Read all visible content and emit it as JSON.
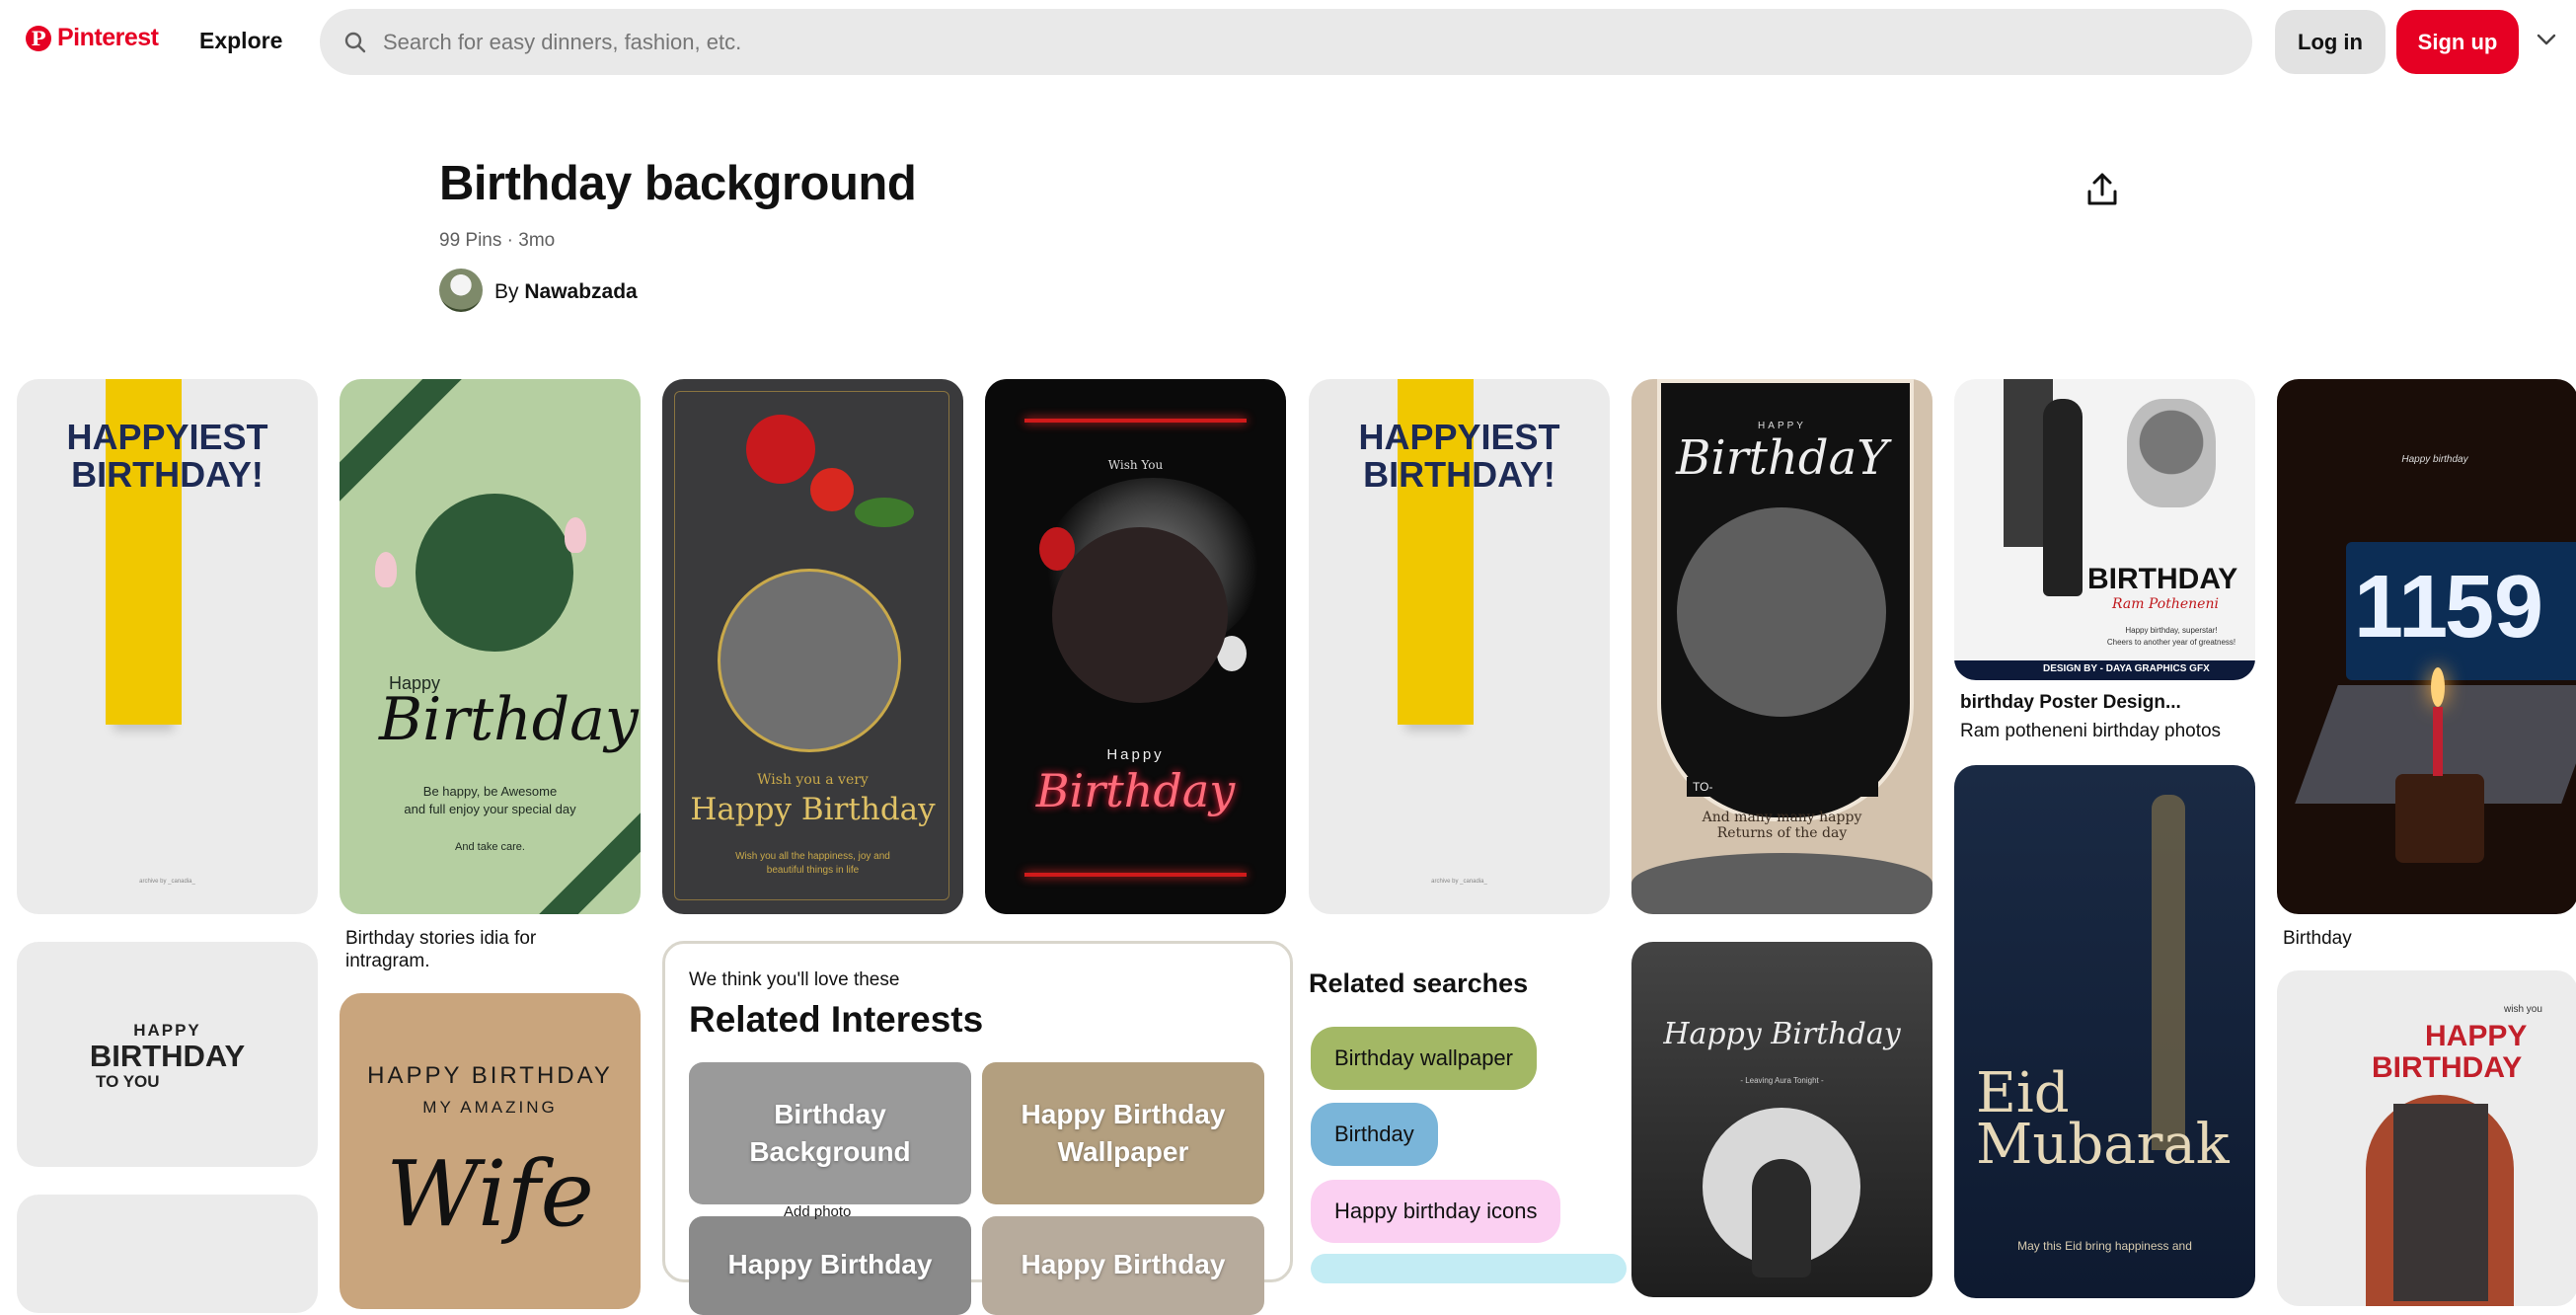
{
  "header": {
    "logo_text": "Pinterest",
    "logo_glyph": "P",
    "explore_label": "Explore",
    "search_placeholder": "Search for easy dinners, fashion, etc.",
    "login_label": "Log in",
    "signup_label": "Sign up",
    "brand_color": "#e60023"
  },
  "board": {
    "title": "Birthday background",
    "meta": "99 Pins · 3mo",
    "by_prefix": "By",
    "author": "Nawabzada"
  },
  "pins": {
    "p1": {
      "line1": "HAPPYIEST",
      "line2": "BIRTHDAY!",
      "small": "archive by _canadia_"
    },
    "p2": {
      "happy": "Happy",
      "script": "Birthday",
      "text1": "Be happy, be Awesome",
      "text2": "and full enjoy your special day",
      "text3": "And take care.",
      "caption1": "Birthday stories idia for",
      "caption2": "intragram."
    },
    "p3": {
      "wish": "Wish you a very",
      "title": "Happy Birthday",
      "small1": "Wish you all the happiness, joy and",
      "small2": "beautiful things in life"
    },
    "p4": {
      "wish": "Wish You",
      "happy": "Happy",
      "script": "Birthday"
    },
    "p5": {
      "line1": "HAPPYIEST",
      "line2": "BIRTHDAY!",
      "small": "archive by _canadia_"
    },
    "p6": {
      "happy": "HAPPY",
      "script": "BirthdaY",
      "to": "TO-",
      "text1": "And many many happy",
      "text2": "Returns of the day"
    },
    "p7": {
      "big": "BIRTHDAY",
      "script": "Ram Potheneni",
      "small1": "Happy birthday, superstar!",
      "small2": "Cheers to another year of greatness!",
      "banner": "DESIGN BY - DAYA GRAPHICS GFX",
      "caption_title": "birthday Poster Design...",
      "caption_sub": "Ram potheneni birthday photos"
    },
    "p8": {
      "clock_h": "11",
      "clock_m": "59",
      "note": "Happy birthday",
      "caption": "Birthday"
    },
    "p9": {
      "happy": "HAPPY",
      "big": "BIRTHDAY",
      "to": "TO YOU"
    },
    "p10": {
      "line1": "HAPPY BIRTHDAY",
      "line2": "MY AMAZING",
      "script": "Wife"
    },
    "p11": {
      "script": "Happy Birthday",
      "sub": "- Leaving Aura Tonight -"
    },
    "p12": {
      "line1": "Eid",
      "line2": "Mubarak",
      "small": "May this Eid bring happiness and"
    },
    "p13": {
      "small": "wish you",
      "line1": "HAPPY",
      "line2": "BIRTHDAY"
    }
  },
  "related_interests": {
    "subtitle": "We think you'll love these",
    "title": "Related Interests",
    "tiles": [
      {
        "label1": "Birthday",
        "label2": "Background"
      },
      {
        "label1": "Happy Birthday",
        "label2": "Wallpaper"
      },
      {
        "label1": "Happy Birthday",
        "label2": ""
      },
      {
        "label1": "Happy Birthday",
        "label2": ""
      }
    ],
    "peek_text": "Add photo"
  },
  "related_searches": {
    "title": "Related searches",
    "chips": [
      {
        "label": "Birthday wallpaper",
        "color": "#a3b865"
      },
      {
        "label": "Birthday",
        "color": "#7ab5d9"
      },
      {
        "label": "Happy birthday icons",
        "color": "#fbd0f2"
      }
    ]
  }
}
